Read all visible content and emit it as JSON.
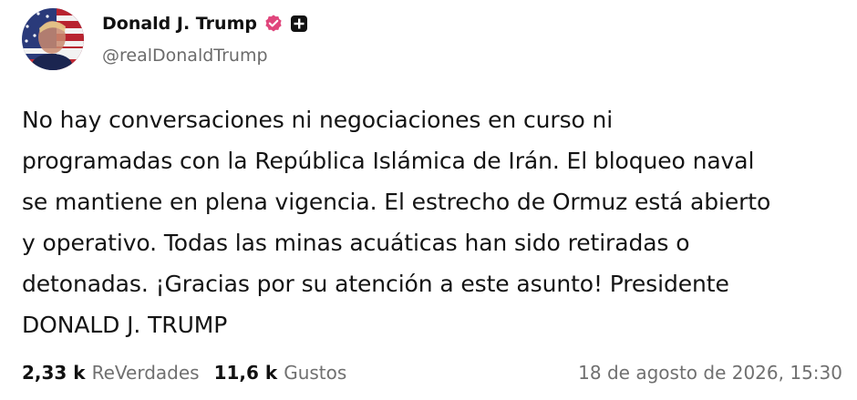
{
  "author": {
    "display_name": "Donald J. Trump",
    "handle": "@realDonaldTrump",
    "avatar_icon": "flag-portrait-avatar",
    "verified_icon": "verified-badge-icon",
    "verified_color": "#e0467c",
    "plus_icon": "plus-square-icon"
  },
  "post": {
    "text": "No hay conversaciones ni negociaciones en curso ni\nprogramadas con la República Islámica de Irán. El bloqueo naval\nse mantiene en plena vigencia. El estrecho de Ormuz está abierto\ny operativo. Todas las minas acuáticas han sido retiradas o\ndetonadas. ¡Gracias por su atención a este asunto! Presidente\nDONALD J. TRUMP"
  },
  "stats": {
    "retruths_count": "2,33 k",
    "retruths_label": "ReVerdades",
    "likes_count": "11,6 k",
    "likes_label": "Gustos"
  },
  "timestamp": "18 de agosto de 2026, 15:30",
  "colors": {
    "text": "#141414",
    "muted": "#707070",
    "background": "#ffffff"
  }
}
